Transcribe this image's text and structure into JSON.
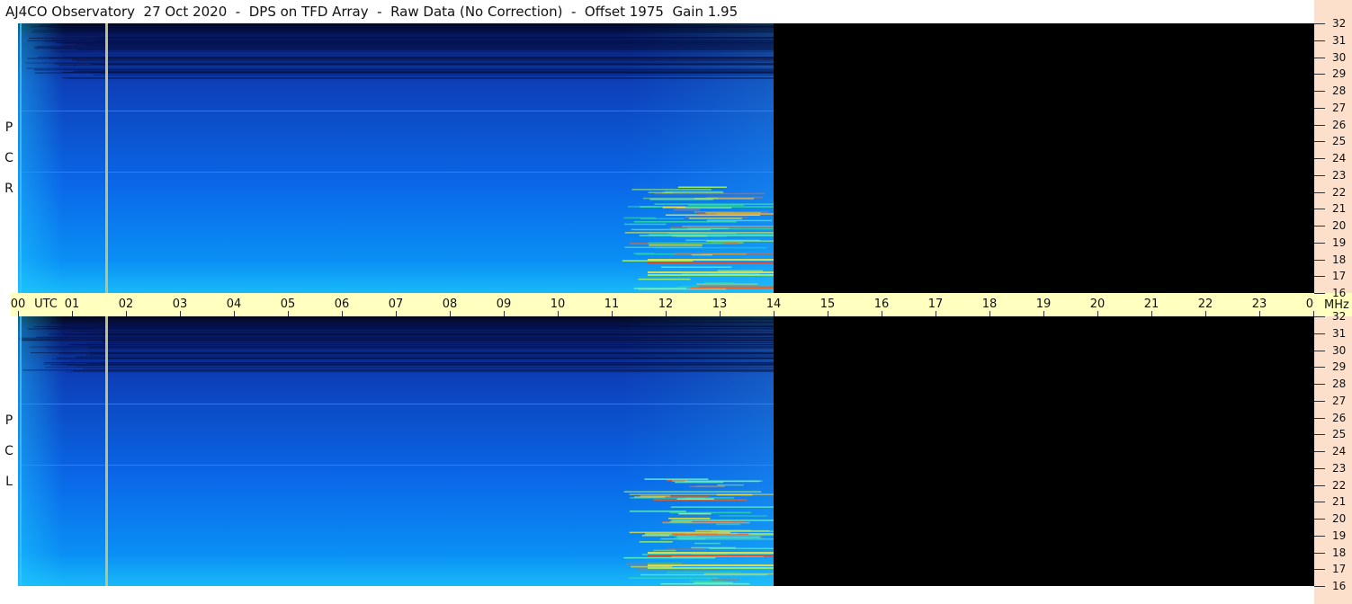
{
  "title": "AJ4CO Observatory  27 Oct 2020  -  DPS on TFD Array  -  Raw Data (No Correction)  -  Offset 1975  Gain 1.95",
  "panels": [
    {
      "id": "rcp",
      "label_letters": [
        "R",
        "C",
        "P"
      ]
    },
    {
      "id": "lcp",
      "label_letters": [
        "L",
        "C",
        "P"
      ]
    }
  ],
  "time_axis": {
    "hours": [
      "00",
      "01",
      "02",
      "03",
      "04",
      "05",
      "06",
      "07",
      "08",
      "09",
      "10",
      "11",
      "12",
      "13",
      "14",
      "15",
      "16",
      "17",
      "18",
      "19",
      "20",
      "21",
      "22",
      "23",
      "00"
    ],
    "utc_label": "UTC",
    "unit": "MHz"
  },
  "freq_axis": {
    "ticks": [
      "32",
      "31",
      "30",
      "29",
      "28",
      "27",
      "26",
      "25",
      "24",
      "23",
      "22",
      "21",
      "20",
      "19",
      "18",
      "17",
      "16"
    ]
  },
  "colors": {
    "strip": "#ffffc0",
    "scale": "#fce0cc",
    "nodata": "#000000"
  },
  "chart_data": {
    "type": "heatmap",
    "title": "AJ4CO Observatory  27 Oct 2020  -  DPS on TFD Array  -  Raw Data (No Correction)  -  Offset 1975  Gain 1.95",
    "xlabel": "UTC",
    "ylabel": "MHz",
    "xlim": [
      0,
      24
    ],
    "ylim": [
      16,
      32
    ],
    "data_end_hour": 14,
    "series": [
      {
        "name": "RCP",
        "data_hours": [
          0,
          14
        ]
      },
      {
        "name": "LCP",
        "data_hours": [
          0,
          14
        ]
      }
    ]
  }
}
